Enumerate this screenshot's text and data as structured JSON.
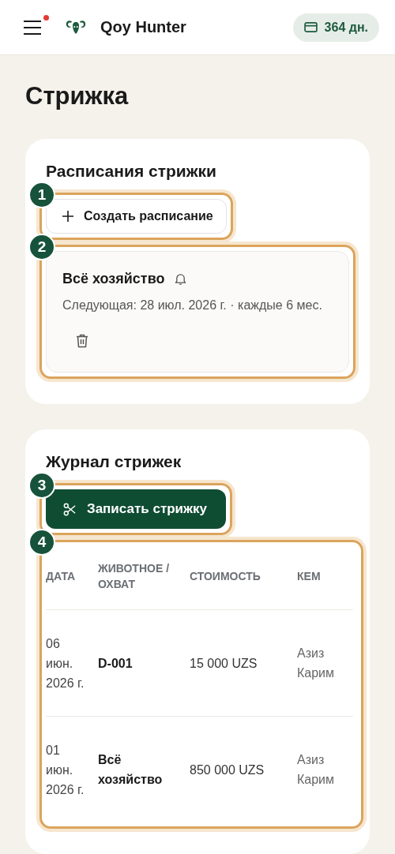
{
  "header": {
    "app_name": "Qoy Hunter",
    "menu_notification": true,
    "subscription": "364 дн."
  },
  "page_title": "Стрижка",
  "schedules": {
    "title": "Расписания стрижки",
    "create_button": {
      "label": "Создать расписание",
      "callout": "1"
    },
    "callout": "2",
    "items": [
      {
        "name": "Всё хозяйство",
        "reminder": true,
        "details": "Следующая: 28 июл. 2026 г. · каждые 6 мес."
      }
    ]
  },
  "log": {
    "title": "Журнал стрижек",
    "record_button": {
      "label": "Записать стрижку",
      "callout": "3"
    },
    "callout": "4",
    "table": {
      "columns": [
        "ДАТА",
        "ЖИВОТНОЕ / ОХВАТ",
        "СТОИМОСТЬ",
        "КЕМ"
      ],
      "rows": [
        [
          "06 июн. 2026 г.",
          "D-001",
          "15 000 UZS",
          "Азиз Карим"
        ],
        [
          "01 июн. 2026 г.",
          "Всё хозяйство",
          "850 000 UZS",
          "Азиз Карим"
        ]
      ]
    }
  }
}
